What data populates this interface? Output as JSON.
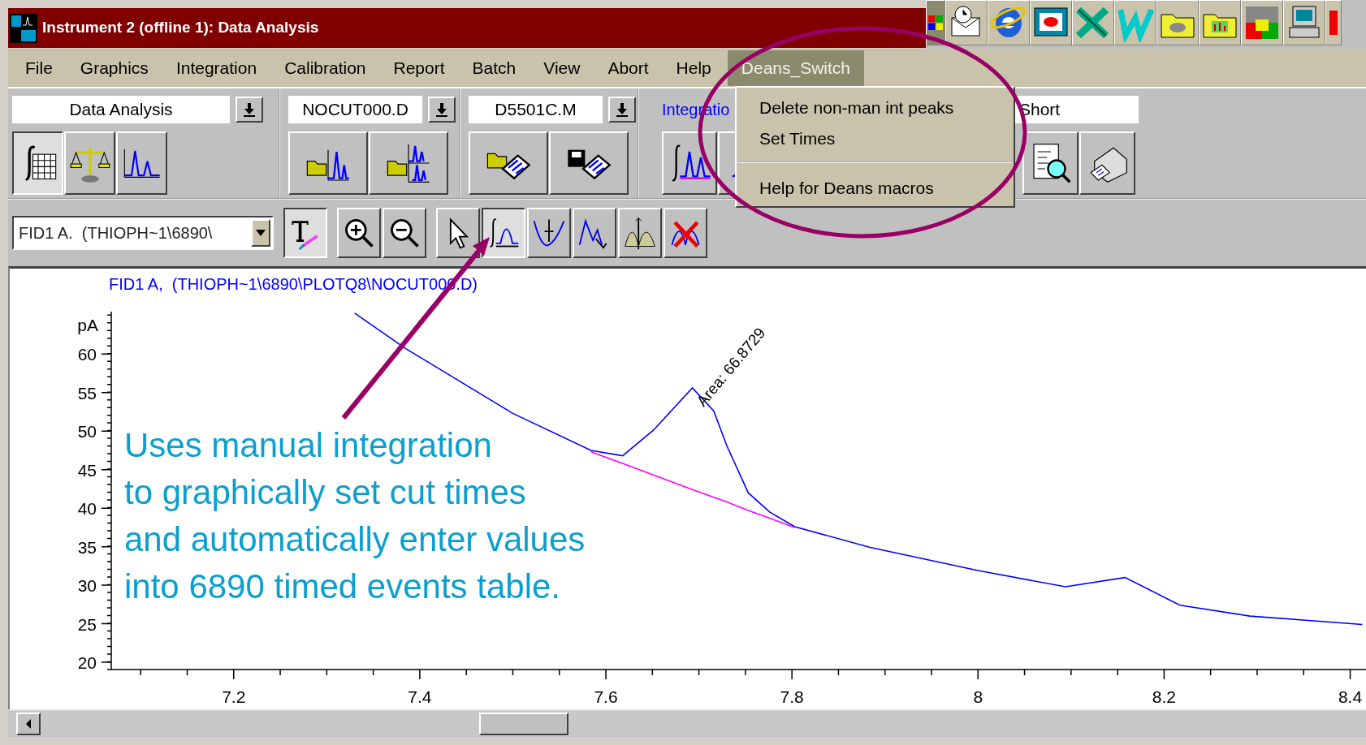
{
  "window": {
    "title": "Instrument 2 (offline 1): Data Analysis"
  },
  "menu_bar": [
    {
      "label": "File",
      "selected": false
    },
    {
      "label": "Graphics",
      "selected": false
    },
    {
      "label": "Integration",
      "selected": false
    },
    {
      "label": "Calibration",
      "selected": false
    },
    {
      "label": "Report",
      "selected": false
    },
    {
      "label": "Batch",
      "selected": false
    },
    {
      "label": "View",
      "selected": false
    },
    {
      "label": "Abort",
      "selected": false
    },
    {
      "label": "Help",
      "selected": false
    },
    {
      "label": "Deans_Switch",
      "selected": true
    }
  ],
  "dropdown_menu": [
    {
      "kind": "item",
      "label": "Delete non-man int peaks"
    },
    {
      "kind": "item",
      "label": "Set Times"
    },
    {
      "kind": "separator"
    },
    {
      "kind": "item",
      "label": "Help for Deans macros"
    }
  ],
  "toolbar": [
    {
      "kind": "combo",
      "text": "Data Analysis",
      "buttons": [
        {
          "kind": "integration-table",
          "pressed": true
        },
        {
          "kind": "calibration",
          "pressed": false
        },
        {
          "kind": "signal",
          "pressed": false
        }
      ]
    },
    {
      "kind": "combo",
      "text": "NOCUT000.D",
      "buttons": [
        {
          "kind": "load-signal",
          "pressed": false
        },
        {
          "kind": "load-multi",
          "pressed": false
        }
      ]
    },
    {
      "kind": "combo",
      "text": "D5501C.M",
      "buttons": [
        {
          "kind": "load-method",
          "pressed": false
        },
        {
          "kind": "save-method",
          "pressed": false
        }
      ]
    },
    {
      "kind": "label",
      "text": "Integratio",
      "buttons": [
        {
          "kind": "integrate",
          "pressed": false
        },
        {
          "kind": "integrate-partial",
          "pressed": false
        }
      ]
    },
    {
      "kind": "field",
      "text": "Short",
      "buttons": [
        {
          "kind": "preview",
          "pressed": false
        },
        {
          "kind": "print",
          "pressed": false
        }
      ]
    }
  ],
  "toolbar_2": {
    "signal_combo": "FID1 A.  (THIOPH~1\\6890\\",
    "button_groups": [
      [
        {
          "kind": "text-tool",
          "pressed": true
        }
      ],
      [
        {
          "kind": "zoom-in",
          "pressed": false
        },
        {
          "kind": "zoom-out",
          "pressed": false
        }
      ],
      [
        {
          "kind": "select",
          "pressed": false
        },
        {
          "kind": "manual-integrate",
          "pressed": true
        },
        {
          "kind": "baseline",
          "pressed": false
        },
        {
          "kind": "peaks",
          "pressed": false
        },
        {
          "kind": "split",
          "pressed": false
        },
        {
          "kind": "delete",
          "pressed": false
        }
      ]
    ]
  },
  "chart": {
    "chart_data": {
      "type": "line",
      "title": "FID1 A,  (THIOPH~1\\6890\\PLOTQ8\\NOCUT000.D)",
      "ylabel": "pA",
      "x": [
        7.33,
        7.385,
        7.5,
        7.584,
        7.618,
        7.651,
        7.693,
        7.716,
        7.73,
        7.753,
        7.776,
        7.803,
        7.884,
        8.0,
        8.094,
        8.158,
        8.217,
        8.292,
        8.413
      ],
      "series": [
        {
          "color": "#0000ff",
          "values": [
            65.3,
            60.7,
            52.3,
            47.5,
            46.8,
            50.1,
            55.6,
            52.6,
            48.1,
            42,
            39.5,
            37.6,
            34.9,
            31.9,
            29.8,
            31.0,
            27.4,
            26.0,
            24.9
          ]
        },
        {
          "color": "#ff00ff",
          "values": [
            null,
            null,
            null,
            47.3,
            45.8,
            44.3,
            42.4,
            41.4,
            40.8,
            39.7,
            38.7,
            37.5,
            null,
            null,
            null,
            null,
            null,
            null,
            null
          ]
        }
      ],
      "xlim": [
        7.0684,
        8.417
      ],
      "ylim": [
        19.06,
        65.5
      ],
      "xticks": [
        7.2,
        7.4,
        7.6,
        7.8,
        8,
        8.2,
        8.4
      ],
      "yticks": [
        20,
        25,
        30,
        35,
        40,
        45,
        50,
        55,
        60
      ],
      "annotations": [
        "Area: 66.8729"
      ]
    }
  },
  "callout": {
    "text": "Uses manual integration\nto graphically set cut times\nand automatically enter values\ninto 6890 timed events table."
  }
}
